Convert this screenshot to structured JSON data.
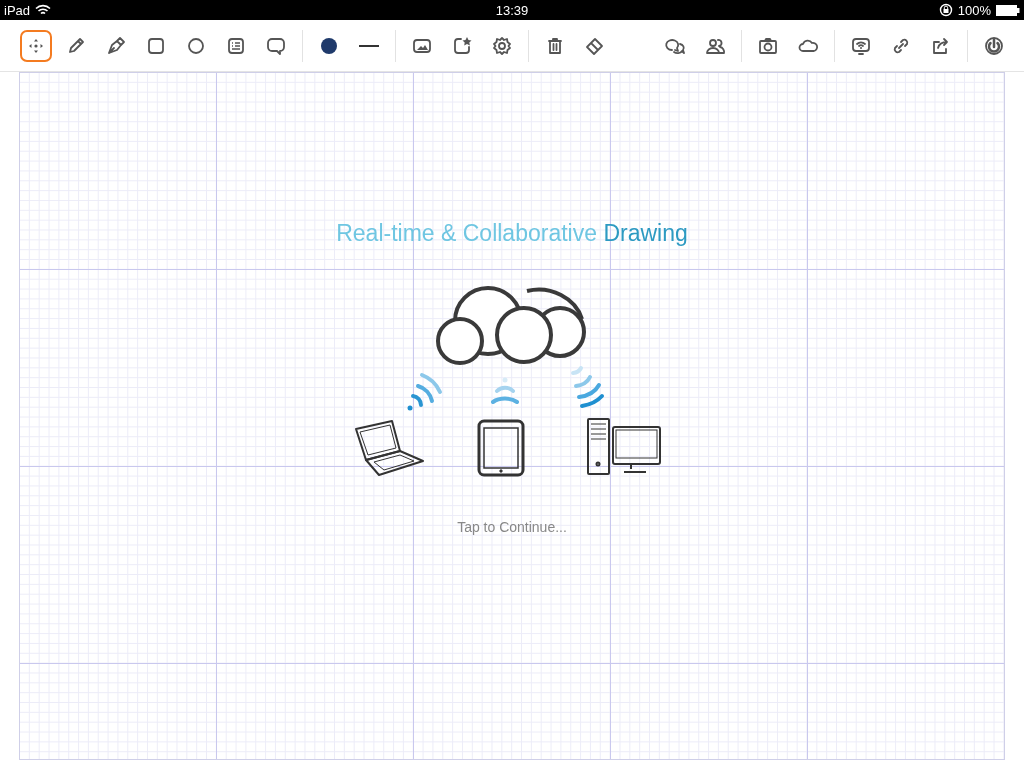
{
  "status_bar": {
    "device": "iPad",
    "time": "13:39",
    "battery": "100%"
  },
  "toolbar": {
    "left_groups": [
      {
        "tools": [
          {
            "kind": "move",
            "selected": true
          },
          {
            "kind": "pencil",
            "selected": false
          },
          {
            "kind": "pen",
            "selected": false
          },
          {
            "kind": "rectangle",
            "selected": false
          },
          {
            "kind": "circle",
            "selected": false
          },
          {
            "kind": "note",
            "selected": false
          },
          {
            "kind": "speech",
            "selected": false
          }
        ]
      },
      {
        "tools": [
          {
            "kind": "color",
            "selected": false
          },
          {
            "kind": "line",
            "selected": false
          }
        ]
      },
      {
        "tools": [
          {
            "kind": "image",
            "selected": false
          },
          {
            "kind": "sticker",
            "selected": false
          },
          {
            "kind": "settings",
            "selected": false
          }
        ]
      },
      {
        "tools": [
          {
            "kind": "trash",
            "selected": false
          },
          {
            "kind": "eraser",
            "selected": false
          }
        ]
      }
    ],
    "right_groups": [
      {
        "tools": [
          {
            "kind": "chat",
            "selected": false
          },
          {
            "kind": "users",
            "selected": false
          }
        ]
      },
      {
        "tools": [
          {
            "kind": "camera",
            "selected": false
          },
          {
            "kind": "cloud",
            "selected": false
          }
        ]
      },
      {
        "tools": [
          {
            "kind": "wifi",
            "selected": false
          },
          {
            "kind": "link",
            "selected": false
          },
          {
            "kind": "share",
            "selected": false
          }
        ]
      },
      {
        "tools": [
          {
            "kind": "power",
            "selected": false
          }
        ]
      }
    ]
  },
  "canvas": {
    "headline": [
      {
        "text": "Real-time & Collaborative",
        "emphasis": false
      },
      {
        "text": "Drawing",
        "emphasis": true
      }
    ],
    "hint": "Tap to Continue..."
  }
}
